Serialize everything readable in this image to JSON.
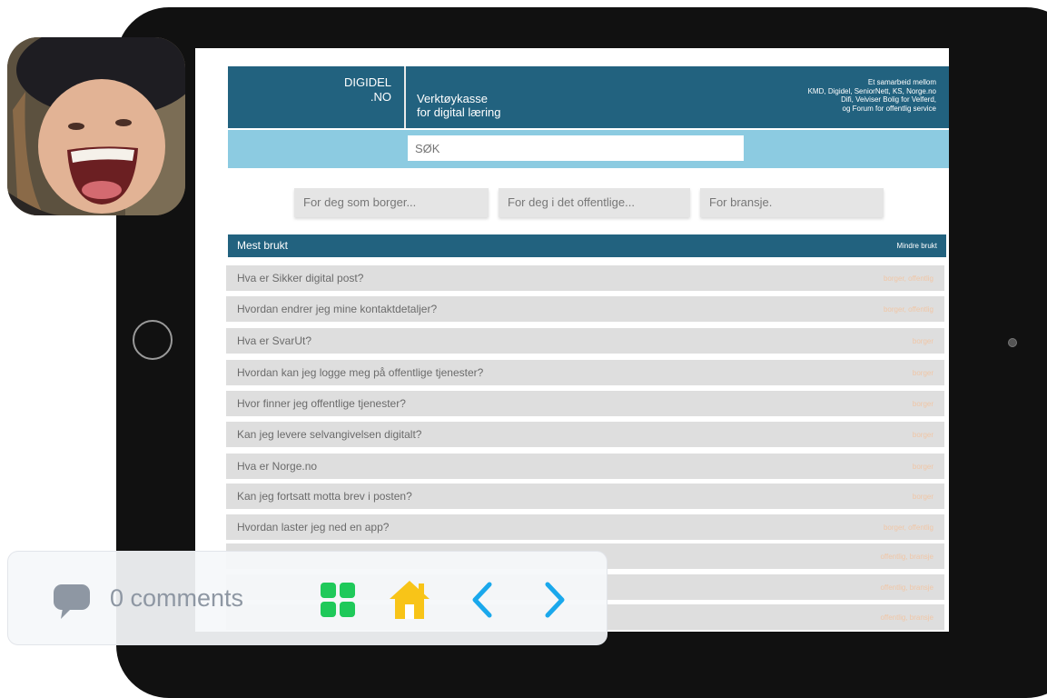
{
  "site": {
    "brand": "DIGIDEL .NO",
    "brand_line1": "DIGIDEL",
    "brand_line2": ".NO",
    "subtitle_line1": "Verktøykasse",
    "subtitle_line2": "for digital læring",
    "collab_lines": [
      "Et samarbeid mellom",
      "KMD, Digidel, SeniorNett, KS, Norge.no",
      "Difi, Veiviser Bolig for Velferd,",
      "og Forum for offentlig service"
    ]
  },
  "search": {
    "placeholder": "SØK"
  },
  "audience_buttons": [
    "For deg som borger...",
    "For deg i det offentlige...",
    "For bransje."
  ],
  "section": {
    "title": "Mest brukt",
    "toggle_label": "Mindre brukt"
  },
  "questions": [
    {
      "text": "Hva er Sikker digital post?",
      "tags": "borger, offentlig"
    },
    {
      "text": "Hvordan endrer jeg mine kontaktdetaljer?",
      "tags": "borger, offentlig"
    },
    {
      "text": "Hva er SvarUt?",
      "tags": "borger"
    },
    {
      "text": "Hvordan kan jeg logge meg på offentlige tjenester?",
      "tags": "borger"
    },
    {
      "text": "Hvor finner jeg offentlige tjenester?",
      "tags": "borger"
    },
    {
      "text": "Kan jeg levere selvangivelsen digitalt?",
      "tags": "borger"
    },
    {
      "text": "Hva er Norge.no",
      "tags": "borger"
    },
    {
      "text": "Kan jeg fortsatt motta brev i posten?",
      "tags": "borger"
    },
    {
      "text": "Hvordan laster jeg ned en app?",
      "tags": "borger, offentlig"
    },
    {
      "text": "",
      "tags": "offentlig, bransje"
    },
    {
      "text": "",
      "tags": "offentlig, bransje"
    },
    {
      "text": "",
      "tags": "offentlig, bransje"
    }
  ],
  "bottom_bar": {
    "comments_label": "0 comments",
    "icons": [
      "comment-icon",
      "grid-icon",
      "home-icon",
      "chevron-left-icon",
      "chevron-right-icon"
    ]
  },
  "colors": {
    "header_blue": "#22627f",
    "search_bar_blue": "#8ccbe1",
    "row_grey": "#dedede",
    "tag_peach": "#f0c6a6",
    "grid_green": "#1fc95a",
    "home_yellow": "#f8c418",
    "chevron_blue": "#1aa8ec",
    "comment_grey": "#8e97a3"
  }
}
